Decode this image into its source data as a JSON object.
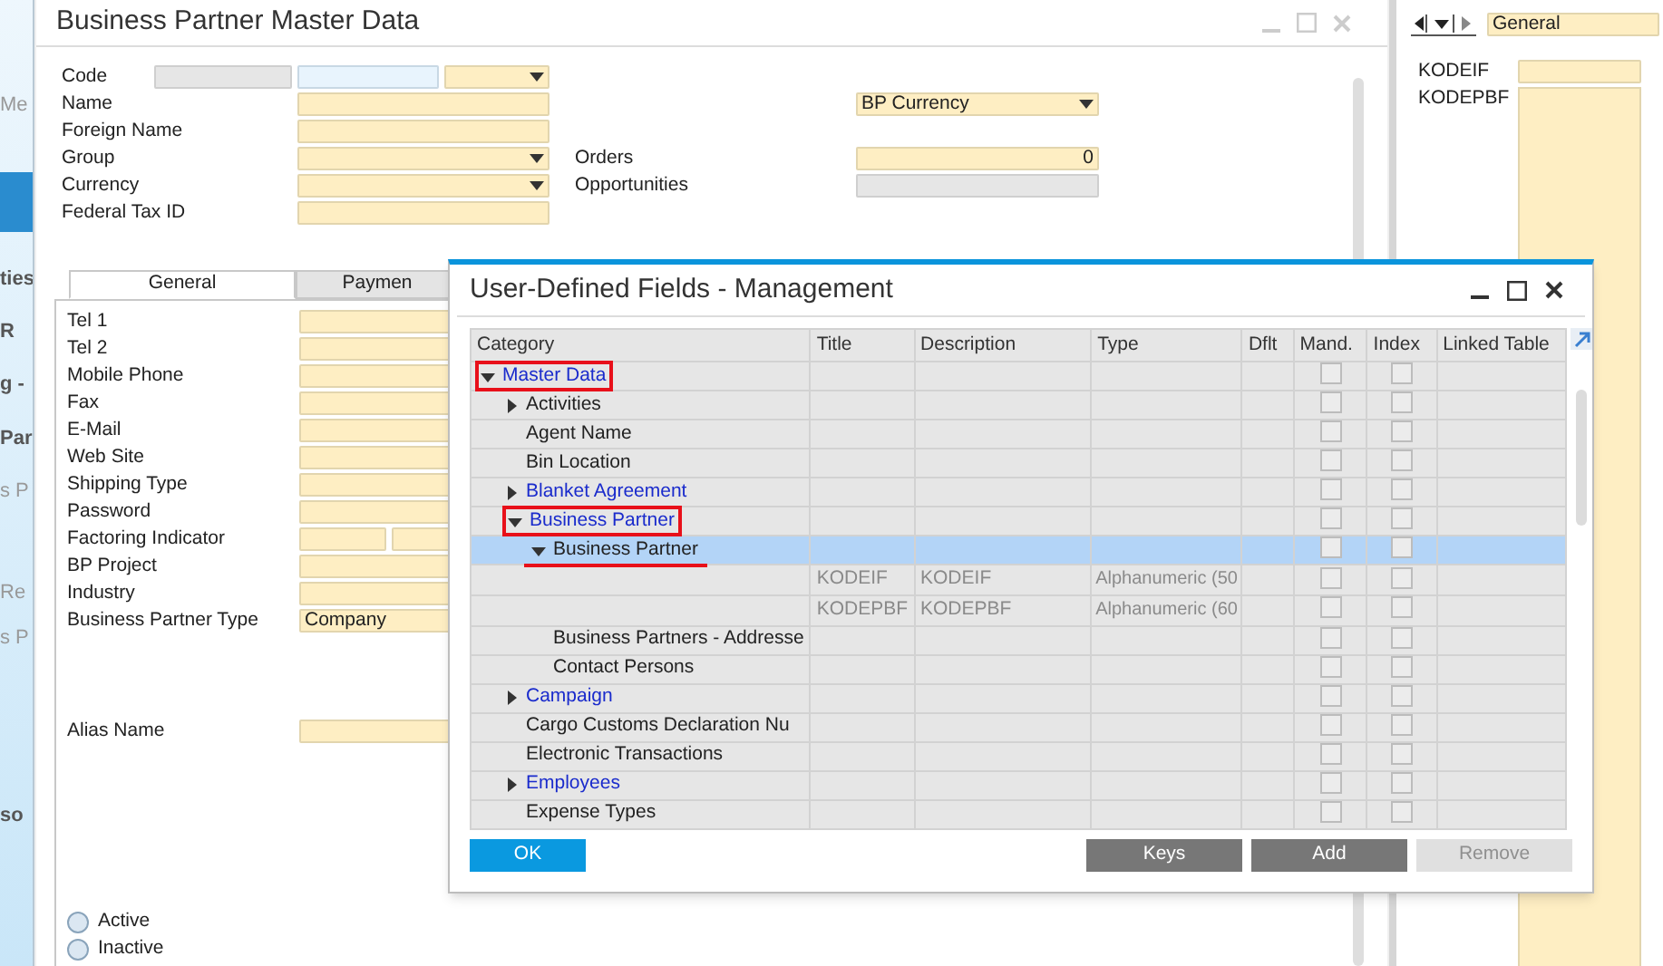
{
  "sidebar": {
    "items": [
      {
        "label": "Me",
        "kind": "faint",
        "selected": false
      },
      {
        "kind": "blank",
        "selected": true
      },
      {
        "label": "ties",
        "kind": "strong",
        "selected": false
      },
      {
        "label": "R",
        "kind": "strong",
        "selected": false
      },
      {
        "label": "g -",
        "kind": "strong",
        "selected": false
      },
      {
        "label": "Par",
        "kind": "strong",
        "selected": false
      },
      {
        "label": "s P",
        "kind": "faint",
        "selected": false
      },
      {
        "label": "Re",
        "kind": "faint",
        "selected": false
      },
      {
        "label": "s P",
        "kind": "faint",
        "selected": false
      },
      {
        "label": "so",
        "kind": "strong",
        "selected": false
      }
    ]
  },
  "bp_window": {
    "title": "Business Partner Master Data",
    "fields": [
      {
        "label": "Code",
        "kind": "code"
      },
      {
        "label": "Name",
        "kind": "text",
        "side": {
          "kind": "dropdown",
          "value": "BP Currency"
        }
      },
      {
        "label": "Foreign Name",
        "kind": "text"
      },
      {
        "label": "Group",
        "kind": "dropdown",
        "side": {
          "kind": "number",
          "label": "Orders",
          "value": "0"
        }
      },
      {
        "label": "Currency",
        "kind": "dropdown",
        "side": {
          "kind": "readonly",
          "label": "Opportunities"
        }
      },
      {
        "label": "Federal Tax ID",
        "kind": "text"
      }
    ],
    "tabs": [
      {
        "label": "General",
        "selected": true
      },
      {
        "label": "Paymen",
        "selected": false
      }
    ],
    "general_fields": [
      {
        "label": "Tel 1",
        "kind": "text"
      },
      {
        "label": "Tel 2",
        "kind": "text"
      },
      {
        "label": "Mobile Phone",
        "kind": "text"
      },
      {
        "label": "Fax",
        "kind": "text"
      },
      {
        "label": "E-Mail",
        "kind": "text"
      },
      {
        "label": "Web Site",
        "kind": "text"
      },
      {
        "label": "Shipping Type",
        "kind": "text"
      },
      {
        "label": "Password",
        "kind": "text"
      },
      {
        "label": "Factoring Indicator",
        "kind": "split"
      },
      {
        "label": "BP Project",
        "kind": "text"
      },
      {
        "label": "Industry",
        "kind": "text"
      },
      {
        "label": "Business Partner Type",
        "kind": "text",
        "value": "Company"
      }
    ],
    "alias_field": {
      "label": "Alias Name"
    },
    "status_options": [
      {
        "label": "Active",
        "selected": false
      },
      {
        "label": "Inactive",
        "selected": false
      }
    ]
  },
  "right_panel": {
    "selector_value": "General",
    "fields": [
      {
        "label": "KODEIF",
        "kind": "line"
      },
      {
        "label": "KODEPBF",
        "kind": "area"
      }
    ]
  },
  "dialog": {
    "title": "User-Defined Fields - Management",
    "columns": [
      "Category",
      "Title",
      "Description",
      "Type",
      "Dflt",
      "Mand.",
      "Index",
      "Linked Table"
    ],
    "rows": [
      {
        "label": "Master Data",
        "linked": true,
        "expanded": true,
        "framed": true,
        "underlined": false,
        "selected": false,
        "mandatory": false,
        "index": false,
        "children": [
          {
            "label": "Activities",
            "linked": false,
            "expanded": false,
            "framed": false,
            "underlined": false,
            "selected": false,
            "mandatory": false,
            "index": false
          },
          {
            "label": "Agent Name",
            "linked": false,
            "framed": false,
            "underlined": false,
            "selected": false,
            "mandatory": false,
            "index": false
          },
          {
            "label": "Bin Location",
            "linked": false,
            "framed": false,
            "underlined": false,
            "selected": false,
            "mandatory": false,
            "index": false
          },
          {
            "label": "Blanket Agreement",
            "linked": true,
            "expanded": false,
            "framed": false,
            "underlined": false,
            "selected": false,
            "mandatory": false,
            "index": false
          },
          {
            "label": "Business Partner",
            "linked": true,
            "expanded": true,
            "framed": true,
            "underlined": false,
            "selected": false,
            "mandatory": false,
            "index": false,
            "children": [
              {
                "label": "Business Partner",
                "linked": false,
                "expanded": true,
                "framed": false,
                "underlined": true,
                "selected": true,
                "mandatory": false,
                "index": false,
                "children": [
                  {
                    "title": "KODEIF",
                    "description": "KODEIF",
                    "type": "Alphanumeric (50",
                    "selected": false,
                    "mandatory": false,
                    "index": false
                  },
                  {
                    "title": "KODEPBF",
                    "description": "KODEPBF",
                    "type": "Alphanumeric (60",
                    "selected": false,
                    "mandatory": false,
                    "index": false
                  }
                ]
              },
              {
                "label": "Business Partners - Addresse",
                "linked": false,
                "framed": false,
                "underlined": false,
                "selected": false,
                "mandatory": false,
                "index": false
              },
              {
                "label": "Contact Persons",
                "linked": false,
                "framed": false,
                "underlined": false,
                "selected": false,
                "mandatory": false,
                "index": false
              }
            ]
          },
          {
            "label": "Campaign",
            "linked": true,
            "expanded": false,
            "framed": false,
            "underlined": false,
            "selected": false,
            "mandatory": false,
            "index": false
          },
          {
            "label": "Cargo Customs Declaration Nu",
            "linked": false,
            "framed": false,
            "underlined": false,
            "selected": false,
            "mandatory": false,
            "index": false
          },
          {
            "label": "Electronic Transactions",
            "linked": false,
            "framed": false,
            "underlined": false,
            "selected": false,
            "mandatory": false,
            "index": false
          },
          {
            "label": "Employees",
            "linked": true,
            "expanded": false,
            "framed": false,
            "underlined": false,
            "selected": false,
            "mandatory": false,
            "index": false
          },
          {
            "label": "Expense Types",
            "linked": false,
            "framed": false,
            "underlined": false,
            "selected": false,
            "mandatory": false,
            "index": false
          }
        ]
      }
    ],
    "buttons": [
      {
        "label": "OK",
        "kind": "primary",
        "disabled": false
      },
      {
        "label": "Keys",
        "kind": "secondary",
        "disabled": false
      },
      {
        "label": "Add",
        "kind": "secondary",
        "disabled": false
      },
      {
        "label": "Remove",
        "kind": "secondary",
        "disabled": true
      }
    ]
  }
}
